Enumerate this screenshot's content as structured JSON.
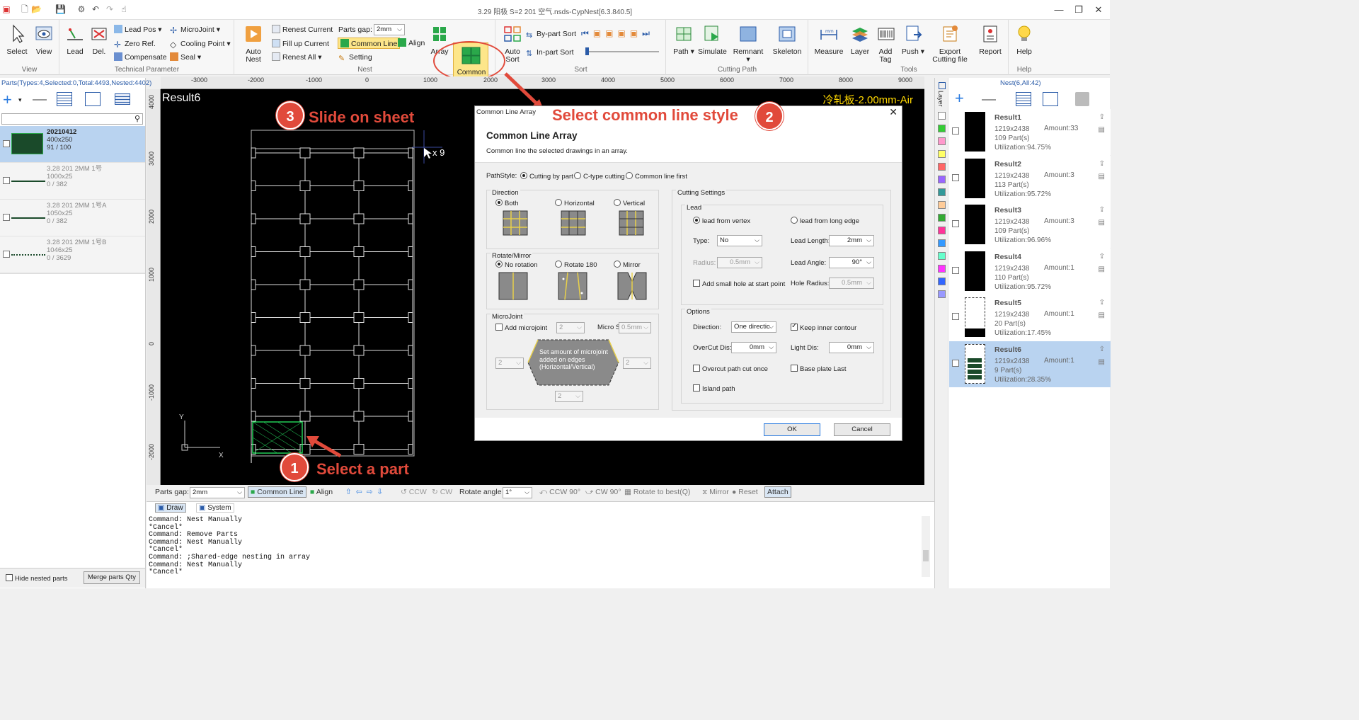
{
  "title_bar": {
    "title": "3.29 阳极  S=2  201  空气.nsds-CypNest[6.3.840.5]",
    "controls": [
      "—",
      "❐",
      "✕"
    ]
  },
  "ribbon": {
    "view_group": {
      "label": "View",
      "select": "Select",
      "view": "View"
    },
    "tech_group": {
      "label": "Technical Parameter",
      "lead": "Lead",
      "del": "Del.",
      "lead_pos": "Lead Pos",
      "zero_ref": "Zero Ref.",
      "compensate": "Compensate",
      "microjoint": "MicroJoint",
      "cooling_point": "Cooling Point",
      "seal": "Seal"
    },
    "nest_group": {
      "label": "Nest",
      "auto_nest": "Auto\nNest",
      "renest_current": "Renest Current",
      "fill_up_current": "Fill up Current",
      "renest_all": "Renest All",
      "parts_gap_label": "Parts gap:",
      "parts_gap_value": "2mm",
      "common_line": "Common Line",
      "align": "Align",
      "setting": "Setting",
      "array": "Array",
      "common_line_array": "Common\nLine Array"
    },
    "sort_group": {
      "label": "Sort",
      "auto_sort": "Auto\nSort",
      "by_part_sort": "By-part Sort",
      "in_part_sort": "In-part Sort"
    },
    "cutting_group": {
      "label": "Cutting Path",
      "path": "Path",
      "simulate": "Simulate",
      "remnant": "Remnant",
      "skeleton": "Skeleton"
    },
    "tools_group": {
      "label": "Tools",
      "measure": "Measure",
      "layer": "Layer",
      "add_tag": "Add\nTag",
      "push": "Push",
      "export": "Export\nCutting file",
      "report": "Report"
    },
    "help_group": {
      "label": "Help",
      "help": "Help"
    }
  },
  "left_panel": {
    "header": "Parts(Types:4,Selected:0,Total:4493,Nested:4402)",
    "parts": [
      {
        "name": "20210412",
        "size": "400x250",
        "count": "91 / 100",
        "selected": true
      },
      {
        "name": "3.28 201 2MM 1号",
        "size": "1000x25",
        "count": "0 / 382",
        "selected": false
      },
      {
        "name": "3.28 201 2MM 1号A",
        "size": "1050x25",
        "count": "0 / 382",
        "selected": false
      },
      {
        "name": "3.28 201 2MM 1号B",
        "size": "1046x25",
        "count": "0 / 3629",
        "selected": false
      }
    ],
    "hide_nested": "Hide nested parts",
    "merge_qty": "Merge parts Qty"
  },
  "ruler_top": [
    "-3000",
    "-2000",
    "-1000",
    "0",
    "1000",
    "2000",
    "3000",
    "4000",
    "5000",
    "6000",
    "7000",
    "8000",
    "9000"
  ],
  "ruler_left": [
    "4000",
    "3000",
    "2000",
    "1000",
    "0",
    "-1000",
    "-2000"
  ],
  "canvas": {
    "result_label": "Result6",
    "material": "冷轧板-2.00mm-Air",
    "multiplier": "x 9",
    "axis_y": "Y",
    "axis_x": "X"
  },
  "annotations": {
    "step1": {
      "num": "1",
      "text": "Select a part"
    },
    "step2": {
      "num": "2",
      "text": "Select common line style"
    },
    "step3": {
      "num": "3",
      "text": "Slide on sheet"
    },
    "color": "#e14a3b"
  },
  "dialog": {
    "window_title": "Common Line Array",
    "title": "Common Line Array",
    "subtitle": "Common line the selected drawings in an array.",
    "path_style_label": "PathStyle:",
    "path_styles": [
      "Cutting by part",
      "C-type cutting",
      "Common line first"
    ],
    "direction": {
      "label": "Direction",
      "options": [
        "Both",
        "Horizontal",
        "Vertical"
      ]
    },
    "rotate": {
      "label": "Rotate/Mirror",
      "options": [
        "No rotation",
        "Rotate 180",
        "Mirror"
      ]
    },
    "microjoint": {
      "label": "MicroJoint",
      "add": "Add microjoint",
      "count": "2",
      "micro_s_label": "Micro S",
      "micro_s_value": "0.5mm",
      "tip": "Set amount of microjoint added on edges (Horizontal/Vertical)",
      "left_value": "2",
      "right_value": "2",
      "bottom_value": "2"
    },
    "cutting_settings": {
      "label": "Cutting Settings",
      "lead_label": "Lead",
      "lead_from_vertex": "lead from vertex",
      "lead_from_long_edge": "lead from long edge",
      "type_label": "Type:",
      "type_value": "No",
      "lead_length_label": "Lead Length:",
      "lead_length_value": "2mm",
      "radius_label": "Radius:",
      "radius_value": "0.5mm",
      "lead_angle_label": "Lead Angle:",
      "lead_angle_value": "90°",
      "add_small_hole": "Add small hole at start point",
      "hole_radius_label": "Hole Radius:",
      "hole_radius_value": "0.5mm"
    },
    "options": {
      "label": "Options",
      "direction_label": "Direction:",
      "direction_value": "One directic",
      "keep_inner": "Keep inner contour",
      "overcut_label": "OverCut Dis:",
      "overcut_value": "0mm",
      "light_label": "Light Dis:",
      "light_value": "0mm",
      "overcut_once": "Overcut path cut once",
      "base_plate_last": "Base plate Last",
      "island_path": "Island path"
    },
    "ok": "OK",
    "cancel": "Cancel"
  },
  "bottom_toolbar": {
    "parts_gap_label": "Parts gap:",
    "parts_gap_value": "2mm",
    "common_line": "Common Line",
    "align": "Align",
    "ccw": "CCW",
    "cw": "CW",
    "rotate_angle_label": "Rotate angle",
    "rotate_angle_value": "1°",
    "ccw90": "CCW 90°",
    "cw90": "CW 90°",
    "rotate_best": "Rotate to best(Q)",
    "mirror": "Mirror",
    "reset": "Reset",
    "attach": "Attach"
  },
  "command": {
    "tabs": [
      "Draw",
      "System"
    ],
    "lines": [
      "Command: Nest Manually",
      "*Cancel*",
      "Command: Remove Parts",
      "Command: Nest Manually",
      "*Cancel*",
      "Command: ;Shared-edge nesting in array",
      "Command: Nest Manually",
      "*Cancel*"
    ]
  },
  "right_panel": {
    "header": "Nest(6,All:42)",
    "layer_label": "Layer",
    "results": [
      {
        "name": "Result1",
        "size": "1219x2438",
        "amount": "Amount:33",
        "parts": "109 Part(s)",
        "util": "Utilization:94.75%",
        "selected": false
      },
      {
        "name": "Result2",
        "size": "1219x2438",
        "amount": "Amount:3",
        "parts": "113 Part(s)",
        "util": "Utilization:95.72%",
        "selected": false
      },
      {
        "name": "Result3",
        "size": "1219x2438",
        "amount": "Amount:3",
        "parts": "109 Part(s)",
        "util": "Utilization:96.96%",
        "selected": false
      },
      {
        "name": "Result4",
        "size": "1219x2438",
        "amount": "Amount:1",
        "parts": "110 Part(s)",
        "util": "Utilization:95.72%",
        "selected": false
      },
      {
        "name": "Result5",
        "size": "1219x2438",
        "amount": "Amount:1",
        "parts": "20 Part(s)",
        "util": "Utilization:17.45%",
        "selected": false
      },
      {
        "name": "Result6",
        "size": "1219x2438",
        "amount": "Amount:1",
        "parts": "9 Part(s)",
        "util": "Utilization:28.35%",
        "selected": true
      }
    ],
    "layer_colors": [
      "#ffffff",
      "#33cc33",
      "#ff99cc",
      "#ffff66",
      "#ff6666",
      "#9966ff",
      "#339999",
      "#ffcc99",
      "#33aa33",
      "#ff3399",
      "#3399ff",
      "#66ffcc",
      "#ff33ff",
      "#3366ff",
      "#9999ff"
    ]
  }
}
